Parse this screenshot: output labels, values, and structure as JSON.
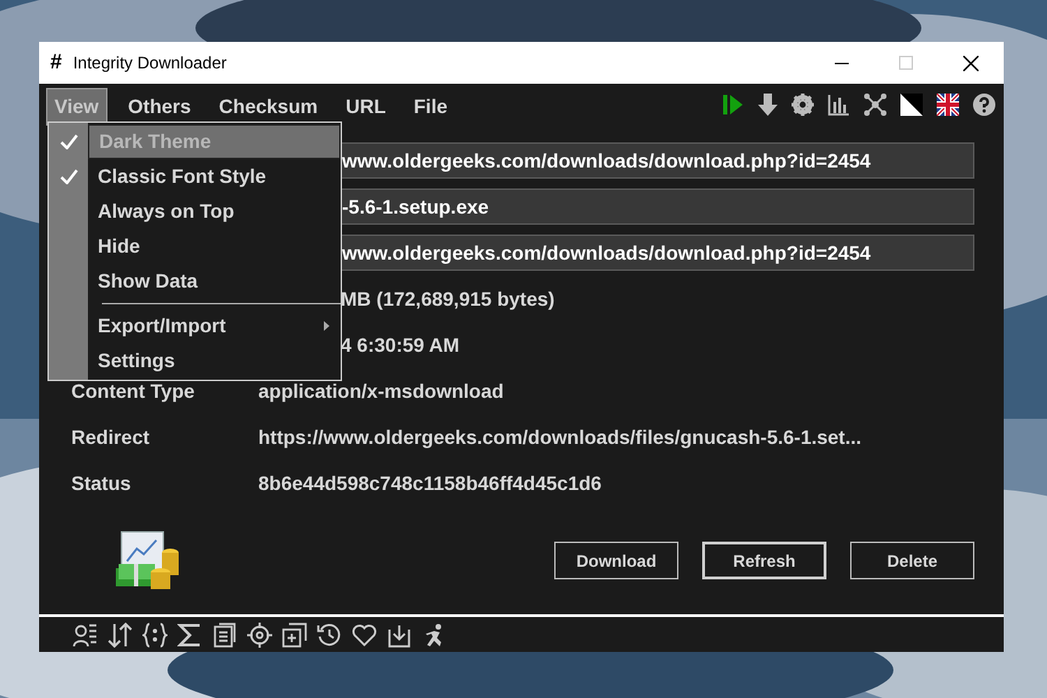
{
  "window": {
    "icon_glyph": "#",
    "title": "Integrity Downloader"
  },
  "menu_bar": [
    {
      "label": "View",
      "selected": true
    },
    {
      "label": "Others",
      "selected": false
    },
    {
      "label": "Checksum",
      "selected": false
    },
    {
      "label": "URL",
      "selected": false
    },
    {
      "label": "File",
      "selected": false
    }
  ],
  "view_menu": [
    {
      "kind": "item",
      "label": "Dark Theme",
      "checked": true,
      "selected": true,
      "has_submenu": false
    },
    {
      "kind": "item",
      "label": "Classic Font Style",
      "checked": true,
      "selected": false,
      "has_submenu": false
    },
    {
      "kind": "item",
      "label": "Always on Top",
      "checked": false,
      "selected": false,
      "has_submenu": false
    },
    {
      "kind": "item",
      "label": "Hide",
      "checked": false,
      "selected": false,
      "has_submenu": false
    },
    {
      "kind": "item",
      "label": "Show Data",
      "checked": false,
      "selected": false,
      "has_submenu": false
    },
    {
      "kind": "separator"
    },
    {
      "kind": "item",
      "label": "Export/Import",
      "checked": false,
      "selected": false,
      "has_submenu": true
    },
    {
      "kind": "item",
      "label": "Settings",
      "checked": false,
      "selected": false,
      "has_submenu": false
    }
  ],
  "fields": [
    {
      "value": "www.oldergeeks.com/downloads/download.php?id=2454"
    },
    {
      "value": "-5.6-1.setup.exe"
    },
    {
      "value": "www.oldergeeks.com/downloads/download.php?id=2454"
    }
  ],
  "details": [
    {
      "value": "MB (172,689,915 bytes)"
    },
    {
      "value": "4 6:30:59 AM"
    },
    {
      "label": "Content Type",
      "value": "application/x-msdownload"
    },
    {
      "label": "Redirect",
      "value": "https://www.oldergeeks.com/downloads/files/gnucash-5.6-1.set..."
    },
    {
      "label": "Status",
      "value": "8b6e44d598c748c1158b46ff4d45c1d6"
    }
  ],
  "buttons": [
    {
      "label": "Download",
      "focused": false
    },
    {
      "label": "Refresh",
      "focused": true
    },
    {
      "label": "Delete",
      "focused": false
    }
  ]
}
